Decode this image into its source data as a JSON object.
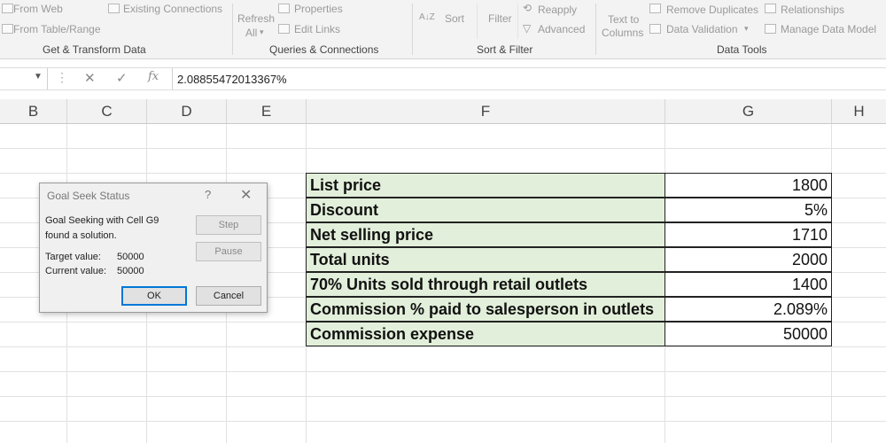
{
  "ribbon": {
    "get_transform": {
      "from_web": "From Web",
      "from_table_range": "From Table/Range",
      "existing_connections": "Existing Connections",
      "group_title": "Get & Transform Data"
    },
    "queries_connections": {
      "refresh_all_line1": "Refresh",
      "refresh_all_line2": "All",
      "properties": "Properties",
      "edit_links": "Edit Links",
      "group_title": "Queries & Connections"
    },
    "sort_filter": {
      "sort_az": "A↓Z",
      "sort": "Sort",
      "filter": "Filter",
      "reapply": "Reapply",
      "advanced": "Advanced",
      "group_title": "Sort & Filter"
    },
    "data_tools": {
      "text_to_columns_line1": "Text to",
      "text_to_columns_line2": "Columns",
      "remove_duplicates": "Remove Duplicates",
      "data_validation": "Data Validation",
      "relationships": "Relationships",
      "manage_data_model": "Manage Data Model",
      "group_title": "Data Tools"
    }
  },
  "formula_bar": {
    "fx": "fx",
    "value": "2.08855472013367%"
  },
  "columns": [
    "B",
    "C",
    "D",
    "E",
    "F",
    "G",
    "H"
  ],
  "table": {
    "rows": [
      {
        "label": "List price",
        "value": "1800"
      },
      {
        "label": "Discount",
        "value": "5%"
      },
      {
        "label": "Net selling price",
        "value": "1710"
      },
      {
        "label": "Total units",
        "value": "2000"
      },
      {
        "label": "70% Units sold through retail outlets",
        "value": "1400"
      },
      {
        "label": "Commission % paid to salesperson in outlets",
        "value": "2.089%"
      },
      {
        "label": "Commission expense",
        "value": "50000"
      }
    ]
  },
  "dialog": {
    "title": "Goal Seek Status",
    "help": "?",
    "close": "✕",
    "message_line1": "Goal Seeking with Cell G9",
    "message_line2": "found a solution.",
    "target_label": "Target value:",
    "target_value": "50000",
    "current_label": "Current value:",
    "current_value": "50000",
    "step": "Step",
    "pause": "Pause",
    "ok": "OK",
    "cancel": "Cancel"
  }
}
